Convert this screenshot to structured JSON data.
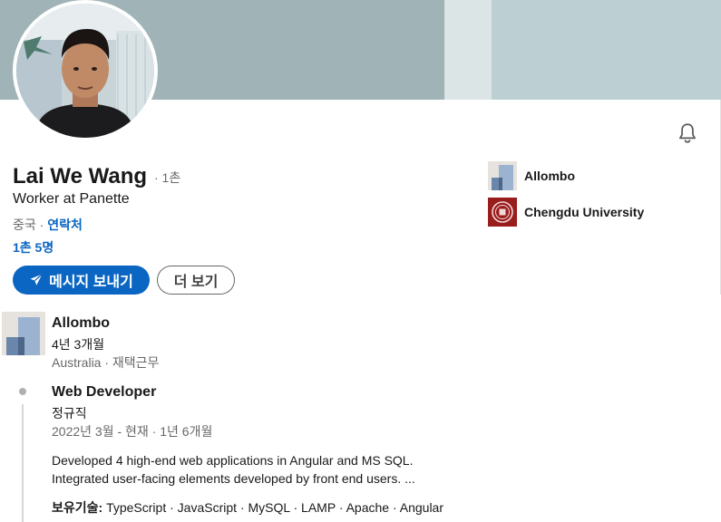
{
  "profile": {
    "name": "Lai We Wang",
    "degree": "· 1촌",
    "headline": "Worker at Panette",
    "location": "중국 ·",
    "contact_info": "연락처",
    "connections": "1촌 5명"
  },
  "actions": {
    "message_label": "메시지 보내기",
    "more_label": "더 보기"
  },
  "side_orgs": [
    {
      "name": "Allombo",
      "logo": "allombo-logo"
    },
    {
      "name": "Chengdu University",
      "logo": "chengdu-university-seal"
    }
  ],
  "experience": {
    "company": "Allombo",
    "duration": "4년 3개월",
    "location": "Australia · 재택근무",
    "role": {
      "title": "Web Developer",
      "employment_type": "정규직",
      "dates": "2022년 3월 - 현재 · 1년 6개월",
      "description_lines": [
        "Developed 4 high-end web applications in Angular and MS SQL.",
        "Integrated user-facing elements developed by front end users. ..."
      ],
      "skills_label": "보유기술:",
      "skills": "TypeScript · JavaScript · MySQL · LAMP · Apache · Angular"
    }
  },
  "icons": {
    "bell": "bell-icon",
    "send": "paper-plane-icon"
  },
  "colors": {
    "primary": "#0a66c2",
    "banner": "#a0b4b7"
  }
}
